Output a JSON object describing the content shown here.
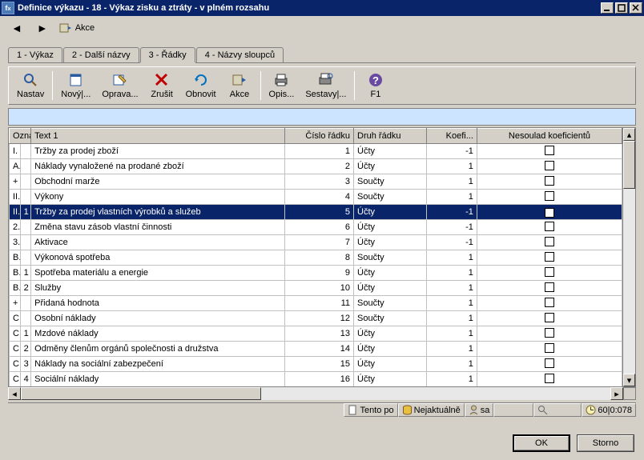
{
  "window": {
    "title": "Definice výkazu - 18 - Výkaz zisku a ztráty - v plném rozsahu"
  },
  "topnav": {
    "akce_label": "Akce"
  },
  "tabs": [
    {
      "label": "1 - Výkaz"
    },
    {
      "label": "2 - Další názvy"
    },
    {
      "label": "3 - Řádky"
    },
    {
      "label": "4 - Názvy sloupců"
    }
  ],
  "toolbar": [
    {
      "name": "nastav",
      "label": "Nastav"
    },
    {
      "name": "novy",
      "label": "Nový|..."
    },
    {
      "name": "oprava",
      "label": "Oprava..."
    },
    {
      "name": "zrusit",
      "label": "Zrušit"
    },
    {
      "name": "obnovit",
      "label": "Obnovit"
    },
    {
      "name": "akce",
      "label": "Akce"
    },
    {
      "name": "opis",
      "label": "Opis..."
    },
    {
      "name": "sestavy",
      "label": "Sestavy|..."
    },
    {
      "name": "f1",
      "label": "F1"
    }
  ],
  "columns": {
    "oznaceni": "Označení",
    "text1": "Text 1",
    "cislo_radku": "Číslo řádku",
    "druh_radku": "Druh řádku",
    "koef": "Koefi...",
    "nesoulad": "Nesoulad koeficientů"
  },
  "rows": [
    {
      "oz1": "I.",
      "oz2": "",
      "text": "Tržby za prodej zboží",
      "cr": 1,
      "dr": "Účty",
      "kf": -1,
      "chk": false,
      "sel": false
    },
    {
      "oz1": "A.",
      "oz2": "",
      "text": "Náklady vynaložené na prodané zboží",
      "cr": 2,
      "dr": "Účty",
      "kf": 1,
      "chk": false,
      "sel": false
    },
    {
      "oz1": "+",
      "oz2": "",
      "text": "Obchodní marže",
      "cr": 3,
      "dr": "Součty",
      "kf": 1,
      "chk": false,
      "sel": false
    },
    {
      "oz1": "II.",
      "oz2": "",
      "text": "Výkony",
      "cr": 4,
      "dr": "Součty",
      "kf": 1,
      "chk": false,
      "sel": false
    },
    {
      "oz1": "II.",
      "oz2": "1",
      "text": "Tržby za prodej vlastních výrobků a služeb",
      "cr": 5,
      "dr": "Účty",
      "kf": -1,
      "chk": true,
      "sel": true
    },
    {
      "oz1": "2.",
      "oz2": "",
      "text": "Změna stavu zásob vlastní činnosti",
      "cr": 6,
      "dr": "Účty",
      "kf": -1,
      "chk": false,
      "sel": false
    },
    {
      "oz1": "3.",
      "oz2": "",
      "text": "Aktivace",
      "cr": 7,
      "dr": "Účty",
      "kf": -1,
      "chk": false,
      "sel": false
    },
    {
      "oz1": "B.",
      "oz2": "",
      "text": "Výkonová spotřeba",
      "cr": 8,
      "dr": "Součty",
      "kf": 1,
      "chk": false,
      "sel": false
    },
    {
      "oz1": "B.",
      "oz2": "1",
      "text": "Spotřeba materiálu a energie",
      "cr": 9,
      "dr": "Účty",
      "kf": 1,
      "chk": false,
      "sel": false
    },
    {
      "oz1": "B.",
      "oz2": "2",
      "text": "Služby",
      "cr": 10,
      "dr": "Účty",
      "kf": 1,
      "chk": false,
      "sel": false
    },
    {
      "oz1": "+",
      "oz2": "",
      "text": "Přidaná hodnota",
      "cr": 11,
      "dr": "Součty",
      "kf": 1,
      "chk": false,
      "sel": false
    },
    {
      "oz1": "C.",
      "oz2": "",
      "text": "Osobní náklady",
      "cr": 12,
      "dr": "Součty",
      "kf": 1,
      "chk": false,
      "sel": false
    },
    {
      "oz1": "C.",
      "oz2": "1",
      "text": "Mzdové náklady",
      "cr": 13,
      "dr": "Účty",
      "kf": 1,
      "chk": false,
      "sel": false
    },
    {
      "oz1": "C.",
      "oz2": "2",
      "text": "Odměny členům orgánů společnosti a družstva",
      "cr": 14,
      "dr": "Účty",
      "kf": 1,
      "chk": false,
      "sel": false
    },
    {
      "oz1": "C.",
      "oz2": "3",
      "text": "Náklady na sociální zabezpečení",
      "cr": 15,
      "dr": "Účty",
      "kf": 1,
      "chk": false,
      "sel": false
    },
    {
      "oz1": "C.",
      "oz2": "4",
      "text": "Sociální náklady",
      "cr": 16,
      "dr": "Účty",
      "kf": 1,
      "chk": false,
      "sel": false
    }
  ],
  "status": {
    "tento": "Tento po",
    "nejaktualne": "Nejaktuálně",
    "user": "sa",
    "time": "60|0:078"
  },
  "buttons": {
    "ok": "OK",
    "storno": "Storno"
  }
}
